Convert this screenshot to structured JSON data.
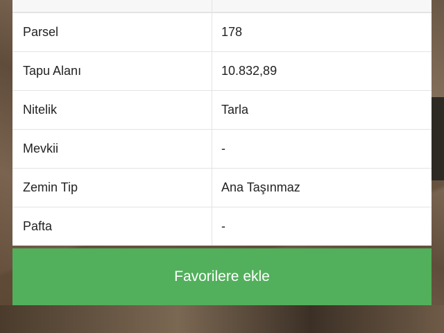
{
  "parcel_info": {
    "rows": [
      {
        "label": "Parsel",
        "value": "178"
      },
      {
        "label": "Tapu Alanı",
        "value": "10.832,89"
      },
      {
        "label": "Nitelik",
        "value": "Tarla"
      },
      {
        "label": "Mevkii",
        "value": "-"
      },
      {
        "label": "Zemin Tip",
        "value": "Ana Taşınmaz"
      },
      {
        "label": "Pafta",
        "value": "-"
      }
    ]
  },
  "actions": {
    "favorite_label": "Favorilere ekle",
    "favorite_color": "#52b05c"
  }
}
